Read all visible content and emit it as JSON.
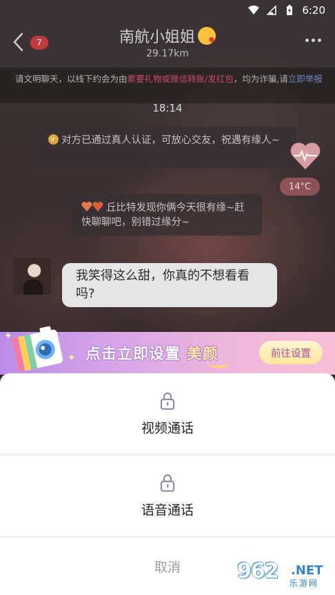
{
  "status_bar": {
    "time": "6:20"
  },
  "header": {
    "unread_count": "7",
    "title": "南航小姐姐",
    "distance": "29.17km"
  },
  "warning": {
    "text_1": "请文明聊天，以线下约会为由",
    "text_red": "索要礼物或微信转账/发红包",
    "text_2": "，均为诈骗,请",
    "link": "立即举报"
  },
  "chat": {
    "time_label": "18:14",
    "system_verify": "对方已通过真人认证，可放心交友，祝遇有缘人~",
    "system_cupid": "丘比特发现你俩今天很有缘~赶快聊聊吧，别错过缘分~",
    "temperature": "14°C",
    "message": "我笑得这么甜，你真的不想看看吗?"
  },
  "beauty_banner": {
    "text_main": "点击立即设置",
    "text_accent": "美颜",
    "button": "前往设置"
  },
  "action_sheet": {
    "video_call": "视频通话",
    "voice_call": "语音通话",
    "cancel": "取消"
  },
  "watermark": {
    "number": "962",
    "suffix": ".NET",
    "cn": "乐游网"
  },
  "colors": {
    "accent_red": "#c23a3a",
    "warning_red": "#c94a6a",
    "link_blue": "#6f86c6",
    "banner_button_text": "#b0499a"
  }
}
